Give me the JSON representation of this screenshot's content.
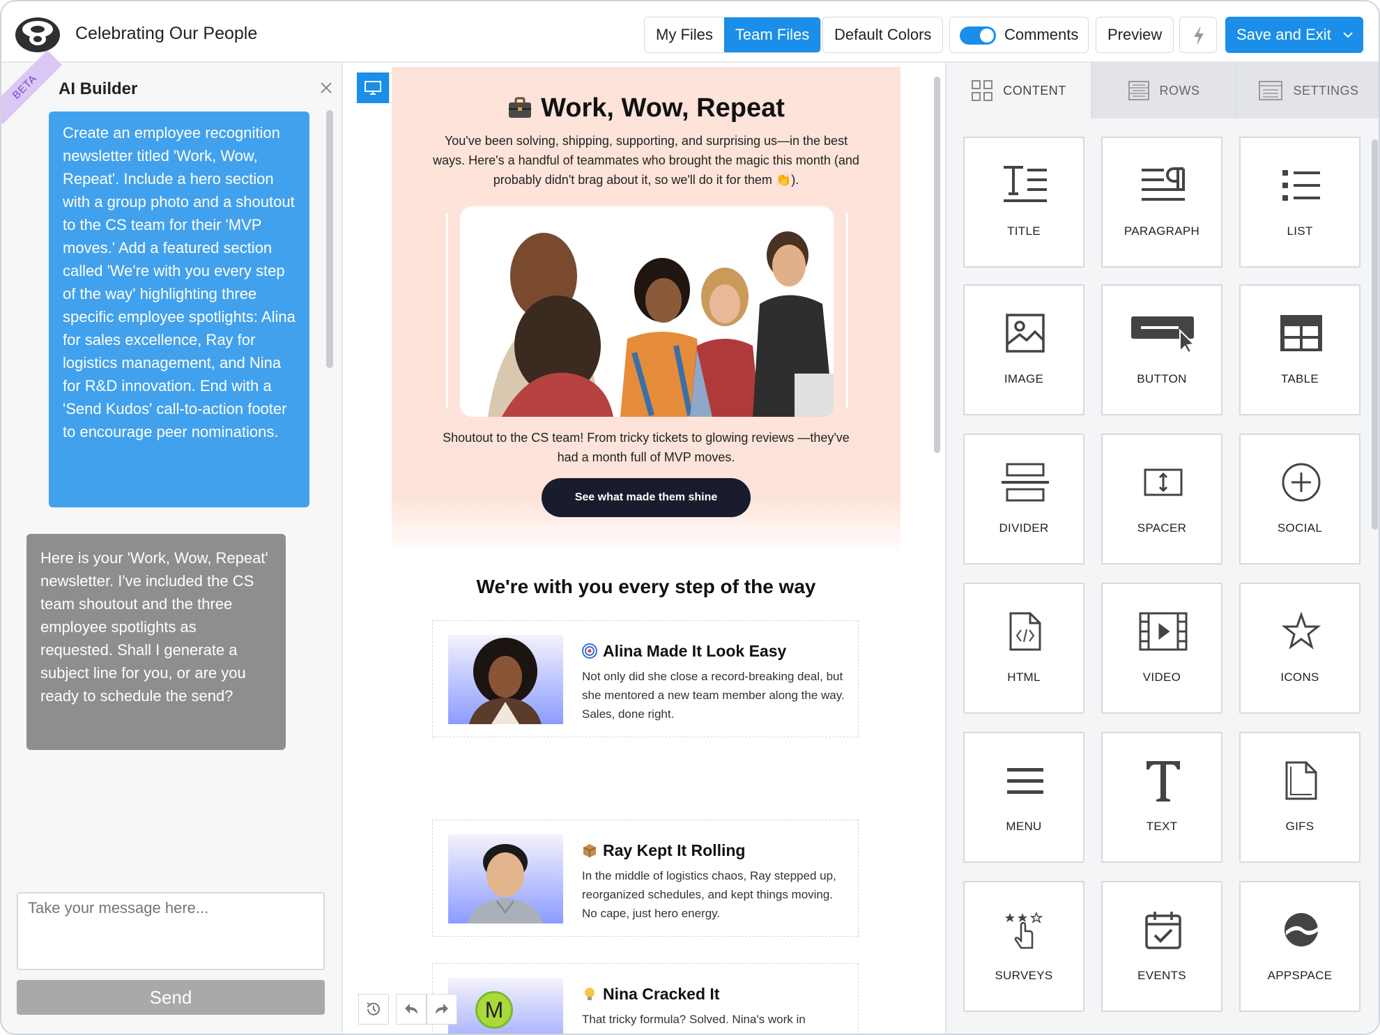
{
  "header": {
    "doc_title": "Celebrating Our People",
    "file_tabs": [
      "My Files",
      "Team Files"
    ],
    "active_file_tab": "Team Files",
    "default_colors_label": "Default Colors",
    "comments_label": "Comments",
    "comments_enabled": true,
    "preview_label": "Preview",
    "save_label": "Save and Exit",
    "accent_color": "#1a8ee8"
  },
  "ai_panel": {
    "beta_label": "BETA",
    "title": "AI Builder",
    "user_message": "Create an employee recognition newsletter titled 'Work, Wow, Repeat'. Include a hero section with a group photo and a shoutout to the CS team for their 'MVP moves.' Add a featured section called 'We're with you every step of the way' highlighting three specific employee spotlights: Alina for sales excellence, Ray for logistics management, and Nina for R&D innovation. End with a 'Send Kudos' call-to-action footer to encourage peer nominations.",
    "ai_message": "Here is your 'Work, Wow, Repeat' newsletter. I've included the CS team shoutout and the three employee spotlights as requested. Shall I generate a subject line for you, or are you ready to schedule the send?",
    "input_placeholder": "Take your message here...",
    "send_label": "Send"
  },
  "canvas": {
    "hero": {
      "title": "Work, Wow, Repeat",
      "subtitle": "You've been solving, shipping, supporting, and surprising us—in the best ways. Here's a handful of teammates who brought the magic this month (and probably didn't brag about it, so we'll do it for them 👏).",
      "caption": "Shoutout to the CS team! From tricky tickets to glowing reviews —they've had a month full of MVP moves.",
      "cta": "See what made them shine",
      "bg_color": "#fde3d9"
    },
    "section_title": "We're with you every step of the way",
    "spotlights": [
      {
        "emoji": "🎯",
        "name": "Alina Made It Look Easy",
        "description": "Not only did she close a record-breaking deal, but she mentored a new team member along the way. Sales, done right."
      },
      {
        "emoji": "📦",
        "name": "Ray Kept It Rolling",
        "description": "In the middle of logistics chaos, Ray stepped up, reorganized schedules, and kept things moving. No cape, just hero energy."
      },
      {
        "emoji": "💡",
        "name": "Nina Cracked It",
        "description": "That tricky formula? Solved. Nina's work in"
      }
    ],
    "collaborator_initial": "M"
  },
  "right_panel": {
    "tabs": [
      "CONTENT",
      "ROWS",
      "SETTINGS"
    ],
    "active_tab": "CONTENT",
    "blocks": [
      {
        "label": "TITLE",
        "icon": "title-icon"
      },
      {
        "label": "PARAGRAPH",
        "icon": "paragraph-icon"
      },
      {
        "label": "LIST",
        "icon": "list-icon"
      },
      {
        "label": "IMAGE",
        "icon": "image-icon"
      },
      {
        "label": "BUTTON",
        "icon": "button-icon"
      },
      {
        "label": "TABLE",
        "icon": "table-icon"
      },
      {
        "label": "DIVIDER",
        "icon": "divider-icon"
      },
      {
        "label": "SPACER",
        "icon": "spacer-icon"
      },
      {
        "label": "SOCIAL",
        "icon": "social-icon"
      },
      {
        "label": "HTML",
        "icon": "html-icon"
      },
      {
        "label": "VIDEO",
        "icon": "video-icon"
      },
      {
        "label": "ICONS",
        "icon": "star-icon"
      },
      {
        "label": "MENU",
        "icon": "menu-icon"
      },
      {
        "label": "TEXT",
        "icon": "text-icon"
      },
      {
        "label": "GIFS",
        "icon": "gifs-icon"
      },
      {
        "label": "SURVEYS",
        "icon": "surveys-icon"
      },
      {
        "label": "EVENTS",
        "icon": "events-icon"
      },
      {
        "label": "APPSPACE",
        "icon": "appspace-icon"
      }
    ]
  }
}
